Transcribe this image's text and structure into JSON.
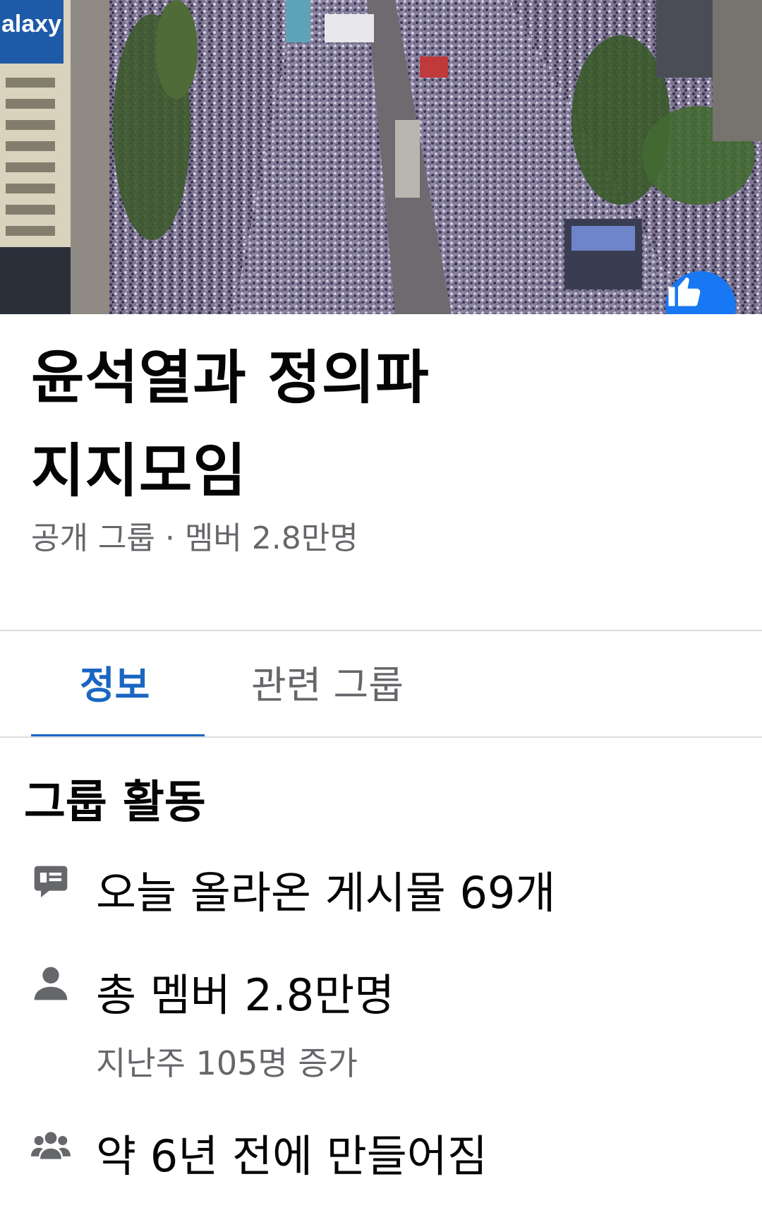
{
  "cover": {
    "billboard_text": "alaxy",
    "description_icon": "like-thumb-icon"
  },
  "header": {
    "title_line1": "윤석열과 정의파",
    "title_line2": "지지모임",
    "meta": "공개 그룹 · 멤버 2.8만명"
  },
  "tabs": [
    {
      "label": "정보",
      "active": true
    },
    {
      "label": "관련 그룹",
      "active": false
    }
  ],
  "activity": {
    "title": "그룹 활동",
    "rows": [
      {
        "icon": "post-bubble-icon",
        "text": "오늘 올라온 게시물 69개",
        "sub": ""
      },
      {
        "icon": "person-icon",
        "text": "총 멤버 2.8만명",
        "sub": "지난주 105명 증가"
      },
      {
        "icon": "group-icon",
        "text": "약 6년 전에 만들어짐",
        "sub": ""
      }
    ]
  },
  "colors": {
    "accent": "#1a66c2",
    "like_badge": "#1877f2",
    "secondary_text": "#65676b",
    "divider": "#dadde1"
  }
}
